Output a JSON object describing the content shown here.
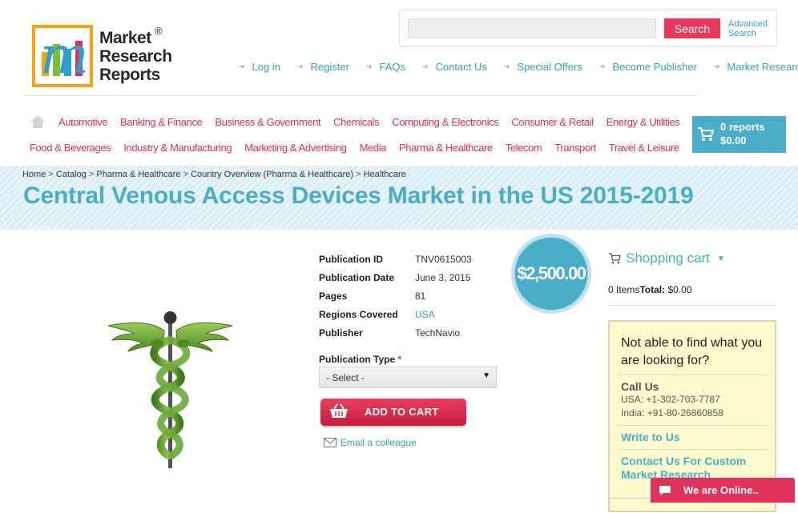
{
  "logo": {
    "lines": [
      "Market",
      "Research",
      "Reports"
    ],
    "reg": "®"
  },
  "search": {
    "placeholder": "",
    "button": "Search",
    "advanced_line1": "Advanced",
    "advanced_line2": "Search"
  },
  "toplinks": [
    "Log in",
    "Register",
    "FAQs",
    "Contact Us",
    "Special Offers",
    "Become Publisher",
    "Market Research Blog"
  ],
  "categories_row1": [
    "Automotive",
    "Banking & Finance",
    "Business & Government",
    "Chemicals",
    "Computing & Electronics",
    "Consumer & Retail",
    "Energy & Utilities"
  ],
  "categories_row2": [
    "Food & Beverages",
    "Industry & Manufacturing",
    "Marketing & Advertising",
    "Media",
    "Pharma & Healthcare",
    "Telecom",
    "Transport",
    "Travel & Leisure"
  ],
  "header_cart": {
    "count": "0 reports",
    "total": "$0.00"
  },
  "breadcrumb": [
    "Home",
    "Catalog",
    "Pharma & Healthcare",
    "Country Overview (Pharma & Healthcare)",
    "Healthcare"
  ],
  "page_title": "Central Venous Access Devices Market in the US 2015-2019",
  "details": [
    {
      "label": "Publication ID",
      "value": "TNV0615003",
      "link": false
    },
    {
      "label": "Publication Date",
      "value": "June 3, 2015",
      "link": false
    },
    {
      "label": "Pages",
      "value": "81",
      "link": false
    },
    {
      "label": "Regions Covered",
      "value": "USA",
      "link": true
    },
    {
      "label": "Publisher",
      "value": "TechNavio",
      "link": false
    }
  ],
  "price": "$2,500.00",
  "publication_type": {
    "label": "Publication Type",
    "required_mark": "*",
    "selected": "- Select -"
  },
  "add_to_cart": "ADD TO CART",
  "email_colleague": "Email a colleague",
  "shopping_cart": {
    "heading": "Shopping cart",
    "items": "0 Items",
    "total_label": "Total:",
    "total_value": "$0.00"
  },
  "help": {
    "question": "Not able to find what you are looking for?",
    "call_us": "Call Us",
    "usa": "USA: +1-302-703-7787",
    "india": "India: +91-80-26860858",
    "write": "Write to Us",
    "custom": "Contact Us For Custom Market Research"
  },
  "chat": "We are Online..",
  "colors": {
    "accent": "#4aaec8",
    "brand_red": "#e0315a",
    "logo_orange": "#f7a21b",
    "help_bg": "#fdfbcd"
  }
}
